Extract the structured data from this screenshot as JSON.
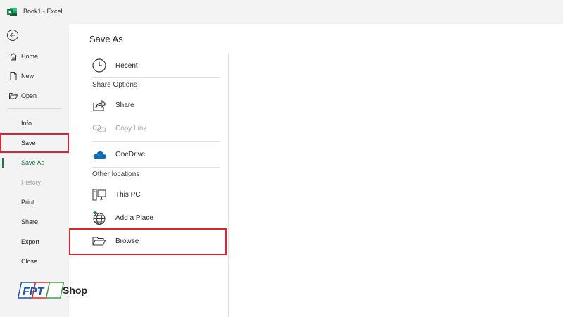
{
  "window": {
    "title": "Book1  -  Excel"
  },
  "colors": {
    "accent": "#107c41",
    "highlight": "#e5202d"
  },
  "nav": {
    "home": "Home",
    "new": "New",
    "open": "Open",
    "info": "Info",
    "save": "Save",
    "save_as": "Save As",
    "history": "History",
    "print": "Print",
    "share": "Share",
    "export": "Export",
    "close": "Close"
  },
  "main": {
    "title": "Save As",
    "recent": "Recent",
    "share_options": "Share Options",
    "share": "Share",
    "copy_link": "Copy Link",
    "onedrive": "OneDrive",
    "other_locations": "Other locations",
    "this_pc": "This PC",
    "add_place": "Add a Place",
    "browse": "Browse"
  },
  "logo": {
    "brand": "FPT",
    "shop": "Shop"
  }
}
